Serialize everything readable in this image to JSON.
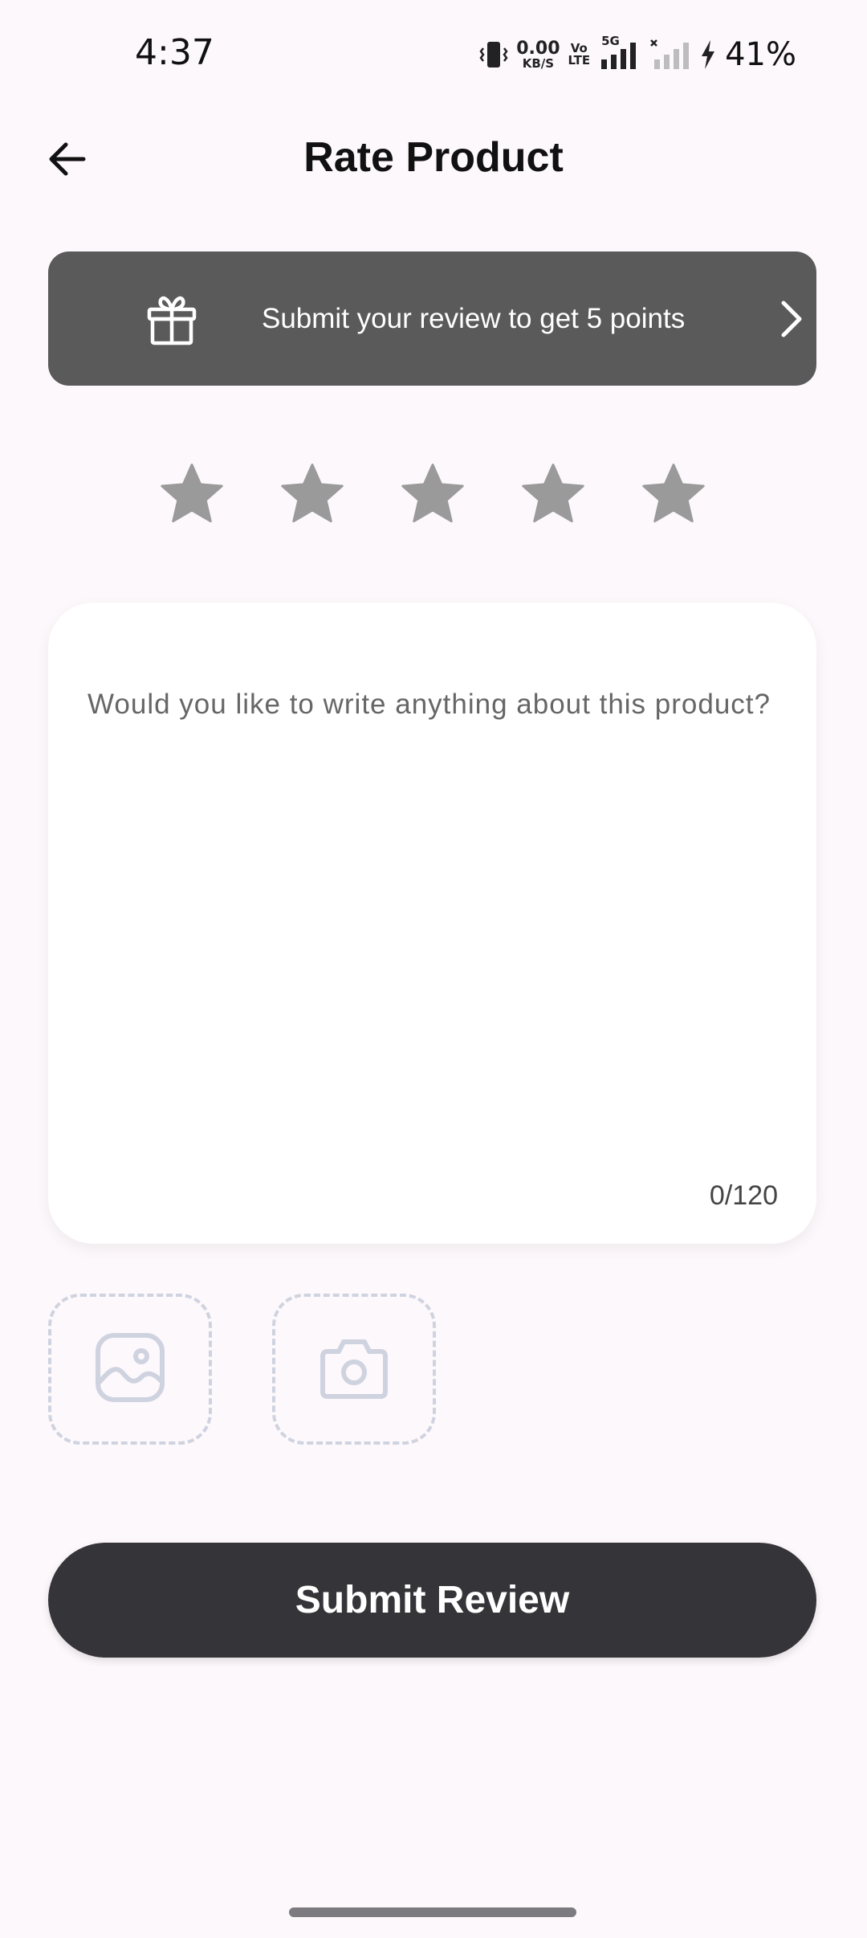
{
  "status_bar": {
    "time": "4:37",
    "net_speed_value": "0.00",
    "net_speed_unit": "KB/S",
    "volte_top": "Vo",
    "volte_bottom": "LTE",
    "network_type": "5G",
    "battery_percent": "41%"
  },
  "header": {
    "title": "Rate Product"
  },
  "promo": {
    "text": "Submit your review to get 5 points"
  },
  "rating": {
    "max_stars": 5,
    "selected": 0,
    "star_color": "#9a9a9a"
  },
  "review": {
    "placeholder": "Would you like to write anything about this product?",
    "char_count": "0/120"
  },
  "uploads": {
    "photo_icon": "image-icon",
    "camera_icon": "camera-icon"
  },
  "submit": {
    "label": "Submit Review"
  },
  "colors": {
    "background": "#fdf8fb",
    "banner": "#5a5a5a",
    "button": "#353438",
    "upload_border": "#cfd3e0"
  }
}
